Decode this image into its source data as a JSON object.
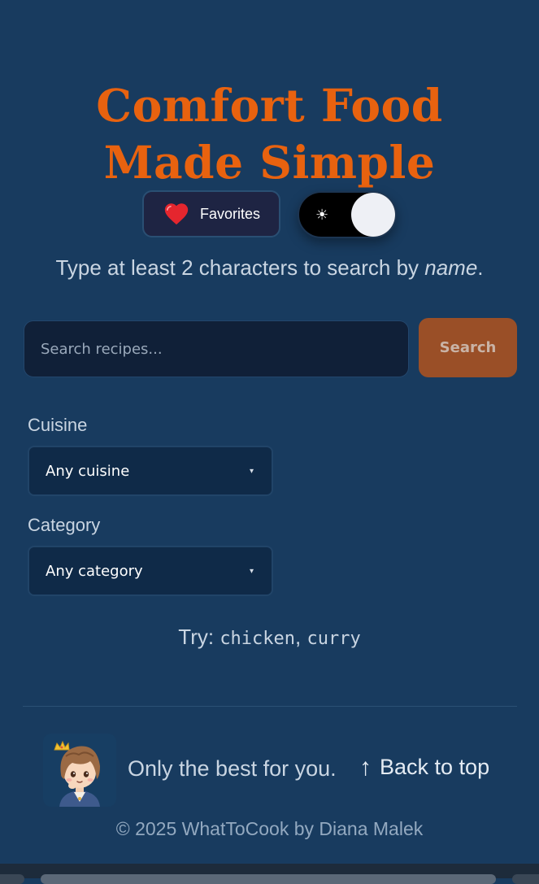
{
  "header": {
    "title_line1": "Comfort Food",
    "title_line2": "Made Simple"
  },
  "favorites": {
    "label": "Favorites",
    "icon": "heart-icon"
  },
  "theme_toggle": {
    "icon": "sun-icon",
    "icon_glyph": "☀",
    "state": "on"
  },
  "hint": {
    "prefix": "Type at least 2 characters to search by ",
    "emphasis": "name",
    "suffix": "."
  },
  "search": {
    "placeholder": "Search recipes...",
    "value": "",
    "button_label": "Search"
  },
  "filters": {
    "cuisine": {
      "label": "Cuisine",
      "selected": "Any cuisine"
    },
    "category": {
      "label": "Category",
      "selected": "Any category"
    },
    "caret_glyph": "▾"
  },
  "suggestions": {
    "prefix": "Try: ",
    "items": [
      "chicken",
      "curry"
    ],
    "separator": ", "
  },
  "footer": {
    "tagline": "Only the best for you.",
    "back_to_top": "Back to top",
    "back_arrow": "↑",
    "copyright": "© 2025 WhatToCook by Diana Malek"
  },
  "colors": {
    "background": "#183b5f",
    "accent": "#e8620f",
    "search_button": "#9a4f27"
  }
}
